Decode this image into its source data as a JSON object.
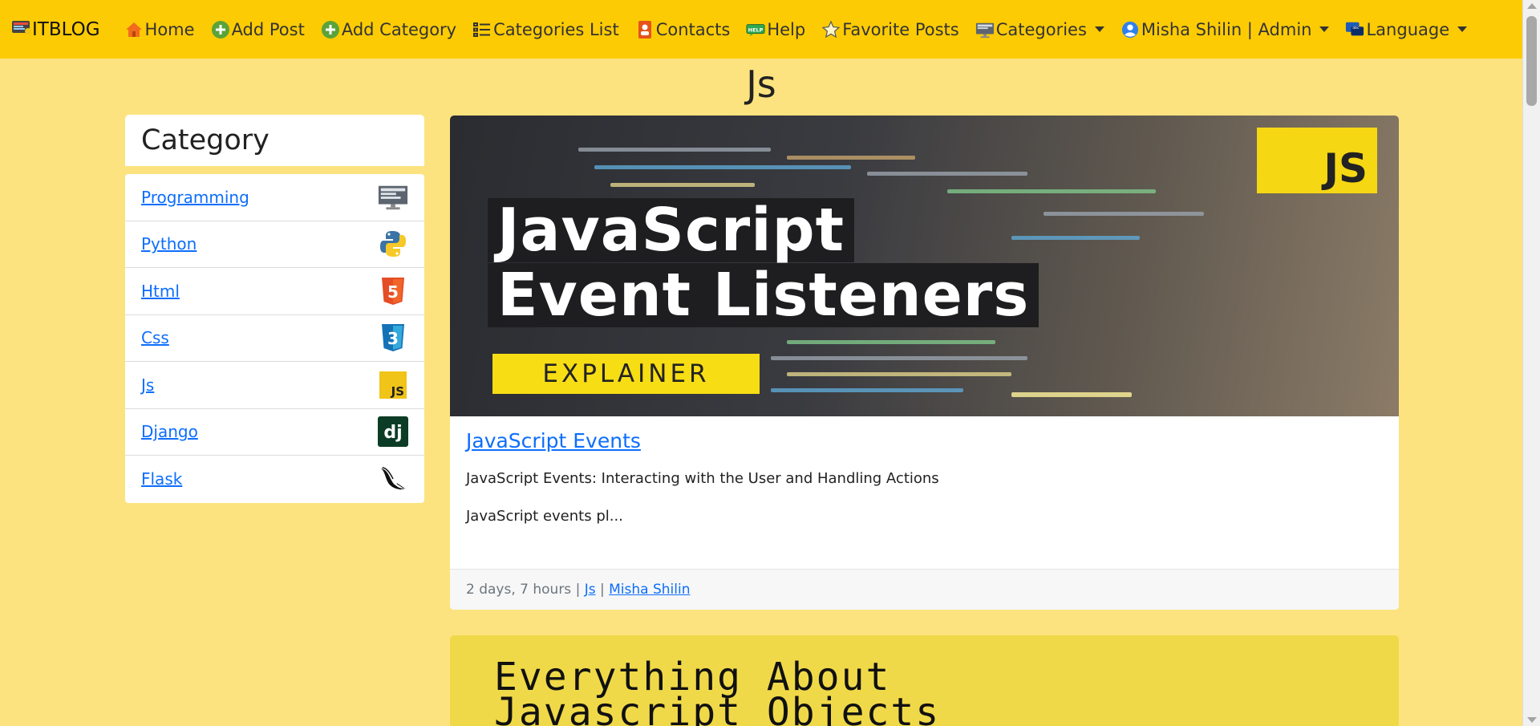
{
  "navbar": {
    "brand": "ITBLOG",
    "items": [
      {
        "label": "Home",
        "icon": "home-icon"
      },
      {
        "label": "Add Post",
        "icon": "add-icon"
      },
      {
        "label": "Add Category",
        "icon": "add-icon"
      },
      {
        "label": "Categories List",
        "icon": "list-icon"
      },
      {
        "label": "Contacts",
        "icon": "contacts-icon"
      },
      {
        "label": "Help",
        "icon": "help-icon"
      },
      {
        "label": "Favorite Posts",
        "icon": "star-icon"
      }
    ],
    "dropdowns": [
      {
        "label": "Categories",
        "icon": "monitor-icon"
      },
      {
        "label": "Misha Shilin | Admin",
        "icon": "user-icon"
      },
      {
        "label": "Language",
        "icon": "language-icon"
      }
    ]
  },
  "page": {
    "title": "Js"
  },
  "sidebar": {
    "header": "Category",
    "items": [
      {
        "label": "Programming",
        "icon": "monitor-icon"
      },
      {
        "label": "Python",
        "icon": "python-icon"
      },
      {
        "label": "Html",
        "icon": "html5-icon"
      },
      {
        "label": "Css",
        "icon": "css3-icon"
      },
      {
        "label": "Js",
        "icon": "js-icon"
      },
      {
        "label": "Django",
        "icon": "django-icon"
      },
      {
        "label": "Flask",
        "icon": "flask-icon"
      }
    ]
  },
  "post": {
    "hero": {
      "line1": "JavaScript",
      "line2": "Event Listeners",
      "badge": "EXPLAINER",
      "logo": "JS"
    },
    "title": "JavaScript Events",
    "summary": "JavaScript Events: Interacting with the User and Handling Actions",
    "excerpt": "JavaScript events pl...",
    "footer": {
      "time": "2 days, 7 hours |",
      "category": "Js",
      "separator": "|",
      "author": "Misha Shilin"
    }
  },
  "post2": {
    "hero_text": "Everything About Javascript Objects"
  },
  "colors": {
    "navbar": "#fdcb04",
    "background": "#fde37f",
    "link": "#0d6efd"
  }
}
